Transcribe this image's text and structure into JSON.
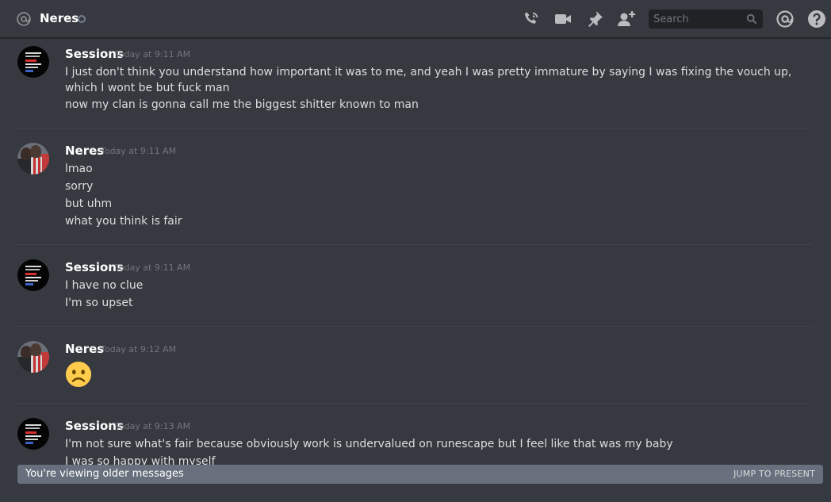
{
  "header": {
    "channel_name": "Neres",
    "search_placeholder": "Search",
    "icons": [
      "at-icon",
      "status-offline-icon",
      "call-icon",
      "video-icon",
      "pin-icon",
      "add-friend-icon",
      "search-icon",
      "mention-icon",
      "help-icon"
    ]
  },
  "messages": [
    {
      "author": "Sessions",
      "timestamp": "Today at 9:11 AM",
      "lines": [
        "I just don't think you understand how important it was to me, and yeah I was pretty immature by saying I was fixing the vouch up, which I wont be but fuck man",
        "now my clan is gonna call me the biggest shitter known to man"
      ]
    },
    {
      "author": "Neres",
      "timestamp": "Today at 9:11 AM",
      "lines": [
        "lmao",
        "sorry",
        "but uhm",
        "what you think is fair"
      ]
    },
    {
      "author": "Sessions",
      "timestamp": "Today at 9:11 AM",
      "lines": [
        "I have no clue",
        "I'm so upset"
      ]
    },
    {
      "author": "Neres",
      "timestamp": "Today at 9:12 AM",
      "emoji": "frowning-face"
    },
    {
      "author": "Sessions",
      "timestamp": "Today at 9:13 AM",
      "lines": [
        "I'm not sure what's fair because obviously work is undervalued on runescape but I feel like that was my baby",
        "I was so happy with myself"
      ]
    }
  ],
  "footer": {
    "older_messages_text": "You're viewing older messages",
    "jump_label": "JUMP TO PRESENT"
  },
  "colors": {
    "background": "#36393f",
    "username": "#ffffff",
    "timestamp": "#72767d",
    "text": "#dcddde",
    "older_bar": "#68707d"
  }
}
